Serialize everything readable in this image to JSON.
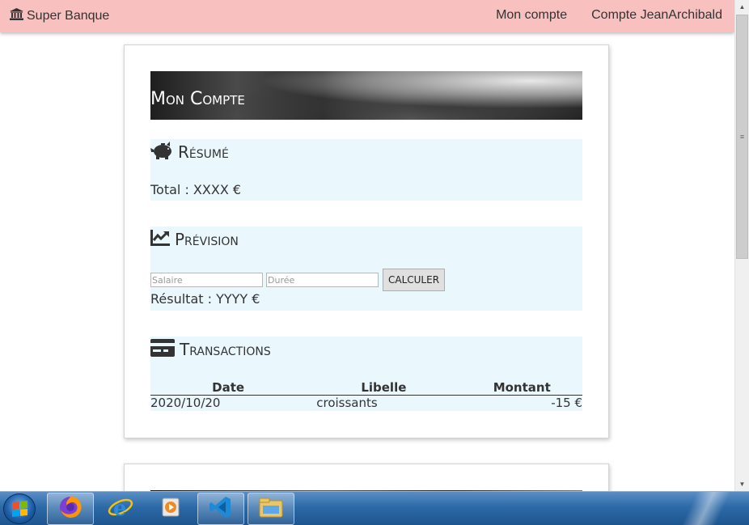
{
  "navbar": {
    "brand_label": "Super Banque",
    "links": [
      "Mon compte",
      "Compte JeanArchibald"
    ]
  },
  "card": {
    "banner_title": "Mon Compte",
    "resume": {
      "title": "Résumé",
      "total_text": "Total : XXXX €"
    },
    "prevision": {
      "title": "Prévision",
      "salaire_placeholder": "Salaire",
      "duree_placeholder": "Durée",
      "button_label": "CALCULER",
      "result_text": "Résultat : YYYY €"
    },
    "transactions": {
      "title": "Transactions",
      "headers": [
        "Date",
        "Libelle",
        "Montant"
      ],
      "rows": [
        [
          "2020/10/20",
          "croissants",
          "-15 €"
        ]
      ]
    }
  },
  "icons": {
    "brand": "bank-icon",
    "resume": "piggy-bank-icon",
    "prevision": "chart-line-icon",
    "transactions": "credit-card-icon"
  },
  "colors": {
    "navbar_bg": "#f9c0c0",
    "section_bg": "#eaf7fd",
    "taskbar": "#2d6aa8"
  }
}
